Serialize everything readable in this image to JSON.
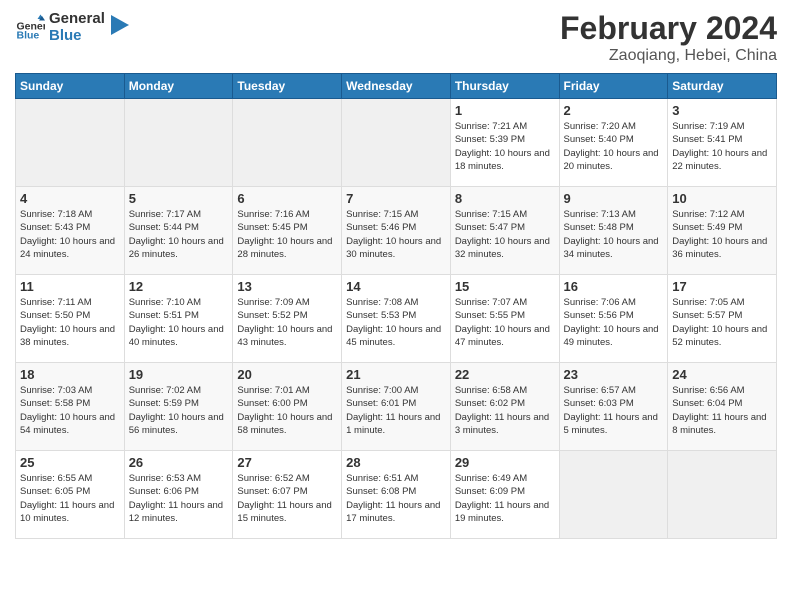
{
  "logo": {
    "text_general": "General",
    "text_blue": "Blue"
  },
  "title": "February 2024",
  "location": "Zaoqiang, Hebei, China",
  "days_of_week": [
    "Sunday",
    "Monday",
    "Tuesday",
    "Wednesday",
    "Thursday",
    "Friday",
    "Saturday"
  ],
  "weeks": [
    [
      {
        "day": "",
        "empty": true
      },
      {
        "day": "",
        "empty": true
      },
      {
        "day": "",
        "empty": true
      },
      {
        "day": "",
        "empty": true
      },
      {
        "day": "1",
        "sunrise": "7:21 AM",
        "sunset": "5:39 PM",
        "daylight": "10 hours and 18 minutes."
      },
      {
        "day": "2",
        "sunrise": "7:20 AM",
        "sunset": "5:40 PM",
        "daylight": "10 hours and 20 minutes."
      },
      {
        "day": "3",
        "sunrise": "7:19 AM",
        "sunset": "5:41 PM",
        "daylight": "10 hours and 22 minutes."
      }
    ],
    [
      {
        "day": "4",
        "sunrise": "7:18 AM",
        "sunset": "5:43 PM",
        "daylight": "10 hours and 24 minutes."
      },
      {
        "day": "5",
        "sunrise": "7:17 AM",
        "sunset": "5:44 PM",
        "daylight": "10 hours and 26 minutes."
      },
      {
        "day": "6",
        "sunrise": "7:16 AM",
        "sunset": "5:45 PM",
        "daylight": "10 hours and 28 minutes."
      },
      {
        "day": "7",
        "sunrise": "7:15 AM",
        "sunset": "5:46 PM",
        "daylight": "10 hours and 30 minutes."
      },
      {
        "day": "8",
        "sunrise": "7:15 AM",
        "sunset": "5:47 PM",
        "daylight": "10 hours and 32 minutes."
      },
      {
        "day": "9",
        "sunrise": "7:13 AM",
        "sunset": "5:48 PM",
        "daylight": "10 hours and 34 minutes."
      },
      {
        "day": "10",
        "sunrise": "7:12 AM",
        "sunset": "5:49 PM",
        "daylight": "10 hours and 36 minutes."
      }
    ],
    [
      {
        "day": "11",
        "sunrise": "7:11 AM",
        "sunset": "5:50 PM",
        "daylight": "10 hours and 38 minutes."
      },
      {
        "day": "12",
        "sunrise": "7:10 AM",
        "sunset": "5:51 PM",
        "daylight": "10 hours and 40 minutes."
      },
      {
        "day": "13",
        "sunrise": "7:09 AM",
        "sunset": "5:52 PM",
        "daylight": "10 hours and 43 minutes."
      },
      {
        "day": "14",
        "sunrise": "7:08 AM",
        "sunset": "5:53 PM",
        "daylight": "10 hours and 45 minutes."
      },
      {
        "day": "15",
        "sunrise": "7:07 AM",
        "sunset": "5:55 PM",
        "daylight": "10 hours and 47 minutes."
      },
      {
        "day": "16",
        "sunrise": "7:06 AM",
        "sunset": "5:56 PM",
        "daylight": "10 hours and 49 minutes."
      },
      {
        "day": "17",
        "sunrise": "7:05 AM",
        "sunset": "5:57 PM",
        "daylight": "10 hours and 52 minutes."
      }
    ],
    [
      {
        "day": "18",
        "sunrise": "7:03 AM",
        "sunset": "5:58 PM",
        "daylight": "10 hours and 54 minutes."
      },
      {
        "day": "19",
        "sunrise": "7:02 AM",
        "sunset": "5:59 PM",
        "daylight": "10 hours and 56 minutes."
      },
      {
        "day": "20",
        "sunrise": "7:01 AM",
        "sunset": "6:00 PM",
        "daylight": "10 hours and 58 minutes."
      },
      {
        "day": "21",
        "sunrise": "7:00 AM",
        "sunset": "6:01 PM",
        "daylight": "11 hours and 1 minute."
      },
      {
        "day": "22",
        "sunrise": "6:58 AM",
        "sunset": "6:02 PM",
        "daylight": "11 hours and 3 minutes."
      },
      {
        "day": "23",
        "sunrise": "6:57 AM",
        "sunset": "6:03 PM",
        "daylight": "11 hours and 5 minutes."
      },
      {
        "day": "24",
        "sunrise": "6:56 AM",
        "sunset": "6:04 PM",
        "daylight": "11 hours and 8 minutes."
      }
    ],
    [
      {
        "day": "25",
        "sunrise": "6:55 AM",
        "sunset": "6:05 PM",
        "daylight": "11 hours and 10 minutes."
      },
      {
        "day": "26",
        "sunrise": "6:53 AM",
        "sunset": "6:06 PM",
        "daylight": "11 hours and 12 minutes."
      },
      {
        "day": "27",
        "sunrise": "6:52 AM",
        "sunset": "6:07 PM",
        "daylight": "11 hours and 15 minutes."
      },
      {
        "day": "28",
        "sunrise": "6:51 AM",
        "sunset": "6:08 PM",
        "daylight": "11 hours and 17 minutes."
      },
      {
        "day": "29",
        "sunrise": "6:49 AM",
        "sunset": "6:09 PM",
        "daylight": "11 hours and 19 minutes."
      },
      {
        "day": "",
        "empty": true
      },
      {
        "day": "",
        "empty": true
      }
    ]
  ],
  "labels": {
    "sunrise_prefix": "Sunrise: ",
    "sunset_prefix": "Sunset: ",
    "daylight_prefix": "Daylight: "
  }
}
